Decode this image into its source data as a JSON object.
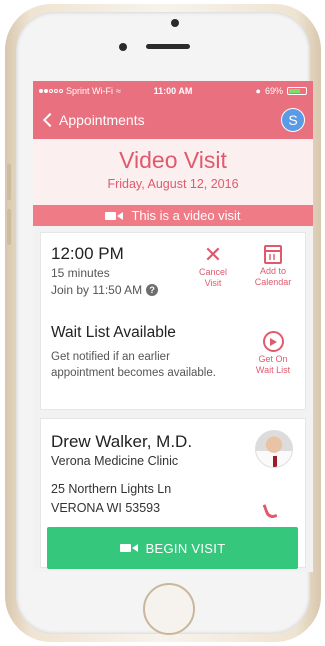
{
  "status_bar": {
    "carrier": "Sprint Wi-Fi",
    "time": "11:00 AM",
    "battery": "69%",
    "battery_level": 0.69
  },
  "nav": {
    "back_label": "Appointments",
    "avatar_initial": "S"
  },
  "header": {
    "title": "Video Visit",
    "date": "Friday, August 12, 2016"
  },
  "banner": {
    "text": "This is a video visit"
  },
  "appointment": {
    "time": "12:00 PM",
    "duration": "15 minutes",
    "join_by": "Join by 11:50 AM",
    "cancel_label_line1": "Cancel",
    "cancel_label_line2": "Visit",
    "calendar_label_line1": "Add to",
    "calendar_label_line2": "Calendar"
  },
  "wait_list": {
    "title": "Wait List Available",
    "description": "Get notified if an earlier appointment becomes available.",
    "action_line1": "Get On",
    "action_line2": "Wait List"
  },
  "provider": {
    "name": "Drew Walker, M.D.",
    "clinic": "Verona Medicine Clinic",
    "address_line1": "25 Northern Lights Ln",
    "address_line2": "VERONA WI 53593"
  },
  "begin_button": {
    "label": "BEGIN VISIT"
  },
  "colors": {
    "accent": "#e8707f",
    "accent_text": "#e15a6c",
    "banner": "#ef7b87",
    "begin_button": "#35c77b",
    "avatar": "#5b9be6"
  }
}
